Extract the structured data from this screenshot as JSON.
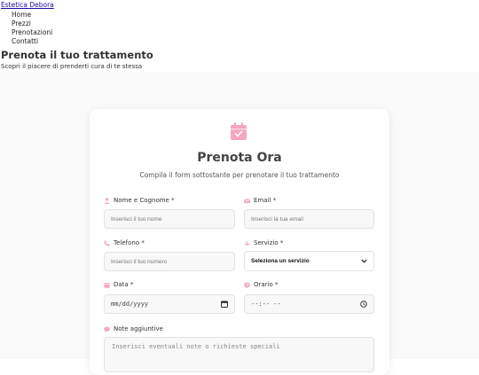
{
  "brand": {
    "name": "Estetica Debora"
  },
  "nav": {
    "items": [
      "Home",
      "Prezzi",
      "Prenotazioni",
      "Contatti"
    ]
  },
  "hero": {
    "title": "Prenota il tuo trattamento",
    "subtitle": "Scopri il piacere di prenderti cura di te stessa"
  },
  "form": {
    "title": "Prenota Ora",
    "description": "Compila il form sottostante per prenotare il tuo trattamento",
    "name": {
      "label": "Nome e Cognome *",
      "placeholder": "Inserisci il tuo nome"
    },
    "email": {
      "label": "Email *",
      "placeholder": "Inserisci la tua email"
    },
    "phone": {
      "label": "Telefono *",
      "placeholder": "Inserisci il tuo numero"
    },
    "service": {
      "label": "Servizio *",
      "selected": "Seleziona un servizio"
    },
    "date": {
      "label": "Data *",
      "value": "mm/dd/yyyy"
    },
    "time": {
      "label": "Orario *",
      "value": "--:-- --"
    },
    "notes": {
      "label": "Note aggiuntive",
      "placeholder": "Inserisci eventuali note o richieste speciali"
    }
  },
  "colors": {
    "accent": "#f4a7c1",
    "background": "#f9f9f9",
    "card": "#ffffff"
  }
}
